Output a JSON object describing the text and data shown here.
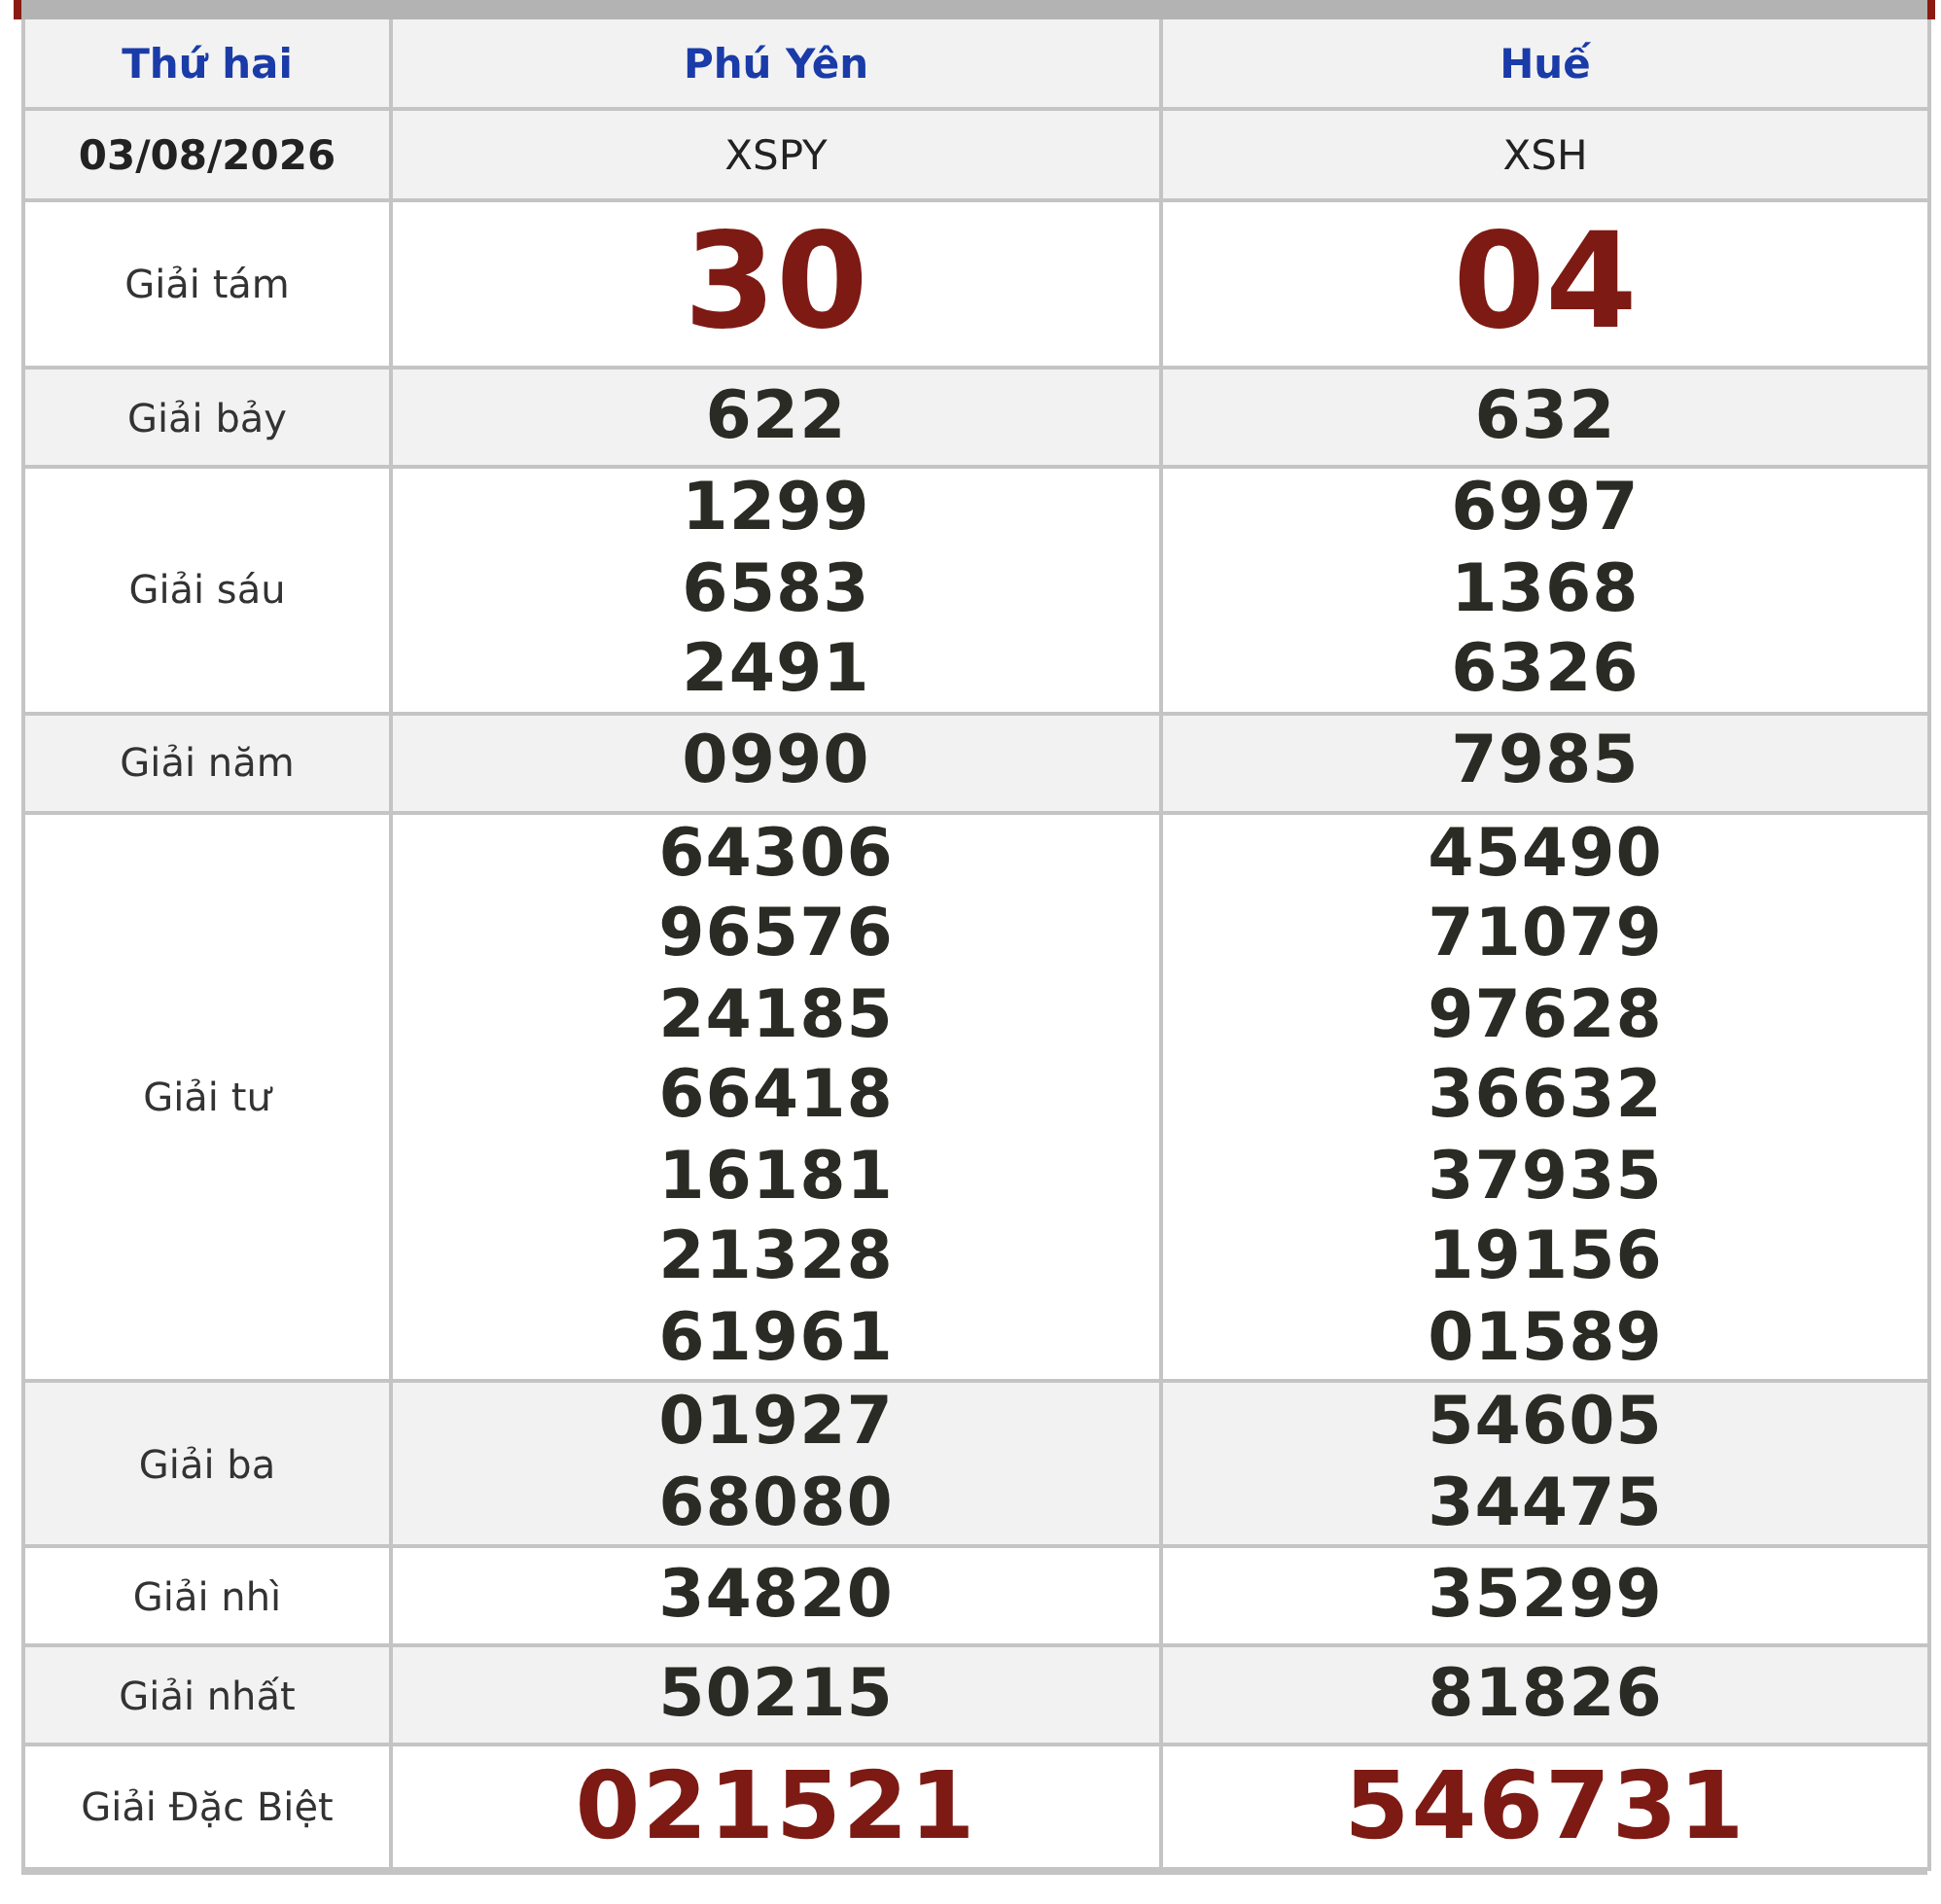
{
  "header": {
    "day": "Thứ hai",
    "provinces": [
      "Phú Yên",
      "Huế"
    ]
  },
  "draw": {
    "date": "03/08/2026",
    "codes": [
      "XSPY",
      "XSH"
    ]
  },
  "prizes": [
    {
      "label": "Giải tám",
      "kind": "eighth",
      "results": [
        [
          "30"
        ],
        [
          "04"
        ]
      ]
    },
    {
      "label": "Giải bảy",
      "kind": "normal",
      "results": [
        [
          "622"
        ],
        [
          "632"
        ]
      ]
    },
    {
      "label": "Giải sáu",
      "kind": "normal",
      "results": [
        [
          "1299",
          "6583",
          "2491"
        ],
        [
          "6997",
          "1368",
          "6326"
        ]
      ]
    },
    {
      "label": "Giải năm",
      "kind": "normal",
      "results": [
        [
          "0990"
        ],
        [
          "7985"
        ]
      ]
    },
    {
      "label": "Giải tư",
      "kind": "normal",
      "results": [
        [
          "64306",
          "96576",
          "24185",
          "66418",
          "16181",
          "21328",
          "61961"
        ],
        [
          "45490",
          "71079",
          "97628",
          "36632",
          "37935",
          "19156",
          "01589"
        ]
      ]
    },
    {
      "label": "Giải ba",
      "kind": "normal",
      "results": [
        [
          "01927",
          "68080"
        ],
        [
          "54605",
          "34475"
        ]
      ]
    },
    {
      "label": "Giải nhì",
      "kind": "normal",
      "results": [
        [
          "34820"
        ],
        [
          "35299"
        ]
      ]
    },
    {
      "label": "Giải nhất",
      "kind": "normal",
      "results": [
        [
          "50215"
        ],
        [
          "81826"
        ]
      ]
    },
    {
      "label": "Giải Đặc Biệt",
      "kind": "special",
      "results": [
        [
          "021521"
        ],
        [
          "546731"
        ]
      ]
    }
  ]
}
